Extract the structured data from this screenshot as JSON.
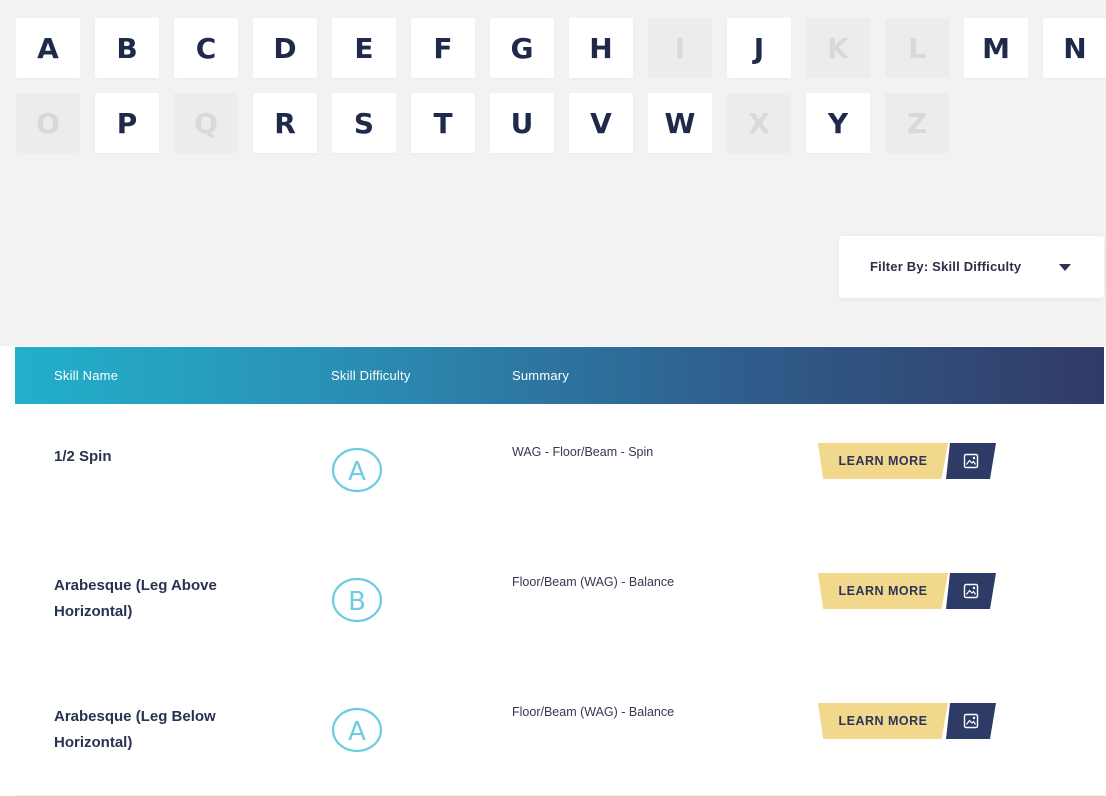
{
  "alphabet": {
    "row1": [
      {
        "letter": "A",
        "enabled": true
      },
      {
        "letter": "B",
        "enabled": true
      },
      {
        "letter": "C",
        "enabled": true
      },
      {
        "letter": "D",
        "enabled": true
      },
      {
        "letter": "E",
        "enabled": true
      },
      {
        "letter": "F",
        "enabled": true
      },
      {
        "letter": "G",
        "enabled": true
      },
      {
        "letter": "H",
        "enabled": true
      },
      {
        "letter": "I",
        "enabled": false
      },
      {
        "letter": "J",
        "enabled": true
      },
      {
        "letter": "K",
        "enabled": false
      },
      {
        "letter": "L",
        "enabled": false
      },
      {
        "letter": "M",
        "enabled": true
      },
      {
        "letter": "N",
        "enabled": true
      }
    ],
    "row2": [
      {
        "letter": "O",
        "enabled": false
      },
      {
        "letter": "P",
        "enabled": true
      },
      {
        "letter": "Q",
        "enabled": false
      },
      {
        "letter": "R",
        "enabled": true
      },
      {
        "letter": "S",
        "enabled": true
      },
      {
        "letter": "T",
        "enabled": true
      },
      {
        "letter": "U",
        "enabled": true
      },
      {
        "letter": "V",
        "enabled": true
      },
      {
        "letter": "W",
        "enabled": true
      },
      {
        "letter": "X",
        "enabled": false
      },
      {
        "letter": "Y",
        "enabled": true
      },
      {
        "letter": "Z",
        "enabled": false
      }
    ]
  },
  "filter": {
    "label": "Filter By: Skill Difficulty",
    "icon": "caret-down-icon"
  },
  "table": {
    "headers": {
      "name": "Skill Name",
      "difficulty": "Skill Difficulty",
      "summary": "Summary"
    },
    "rows": [
      {
        "name": "1/2 Spin",
        "difficulty": "A",
        "summary": "WAG - Floor/Beam - Spin",
        "button": "LEARN MORE",
        "icon": "image-icon"
      },
      {
        "name": "Arabesque (Leg Above Horizontal)",
        "difficulty": "B",
        "summary": "Floor/Beam (WAG) - Balance",
        "button": "LEARN MORE",
        "icon": "image-icon"
      },
      {
        "name": "Arabesque (Leg Below Horizontal)",
        "difficulty": "A",
        "summary": "Floor/Beam (WAG) - Balance",
        "button": "LEARN MORE",
        "icon": "image-icon"
      }
    ]
  },
  "colors": {
    "header_gradient_start": "#22b0cc",
    "header_gradient_end": "#323a66",
    "learn_more_bg": "#f1d88c",
    "icon_button_bg": "#2e3b66",
    "difficulty_circle": "#6fcbe0",
    "letter_text": "#1f2a4a",
    "letter_disabled": "#d9d9dc"
  }
}
